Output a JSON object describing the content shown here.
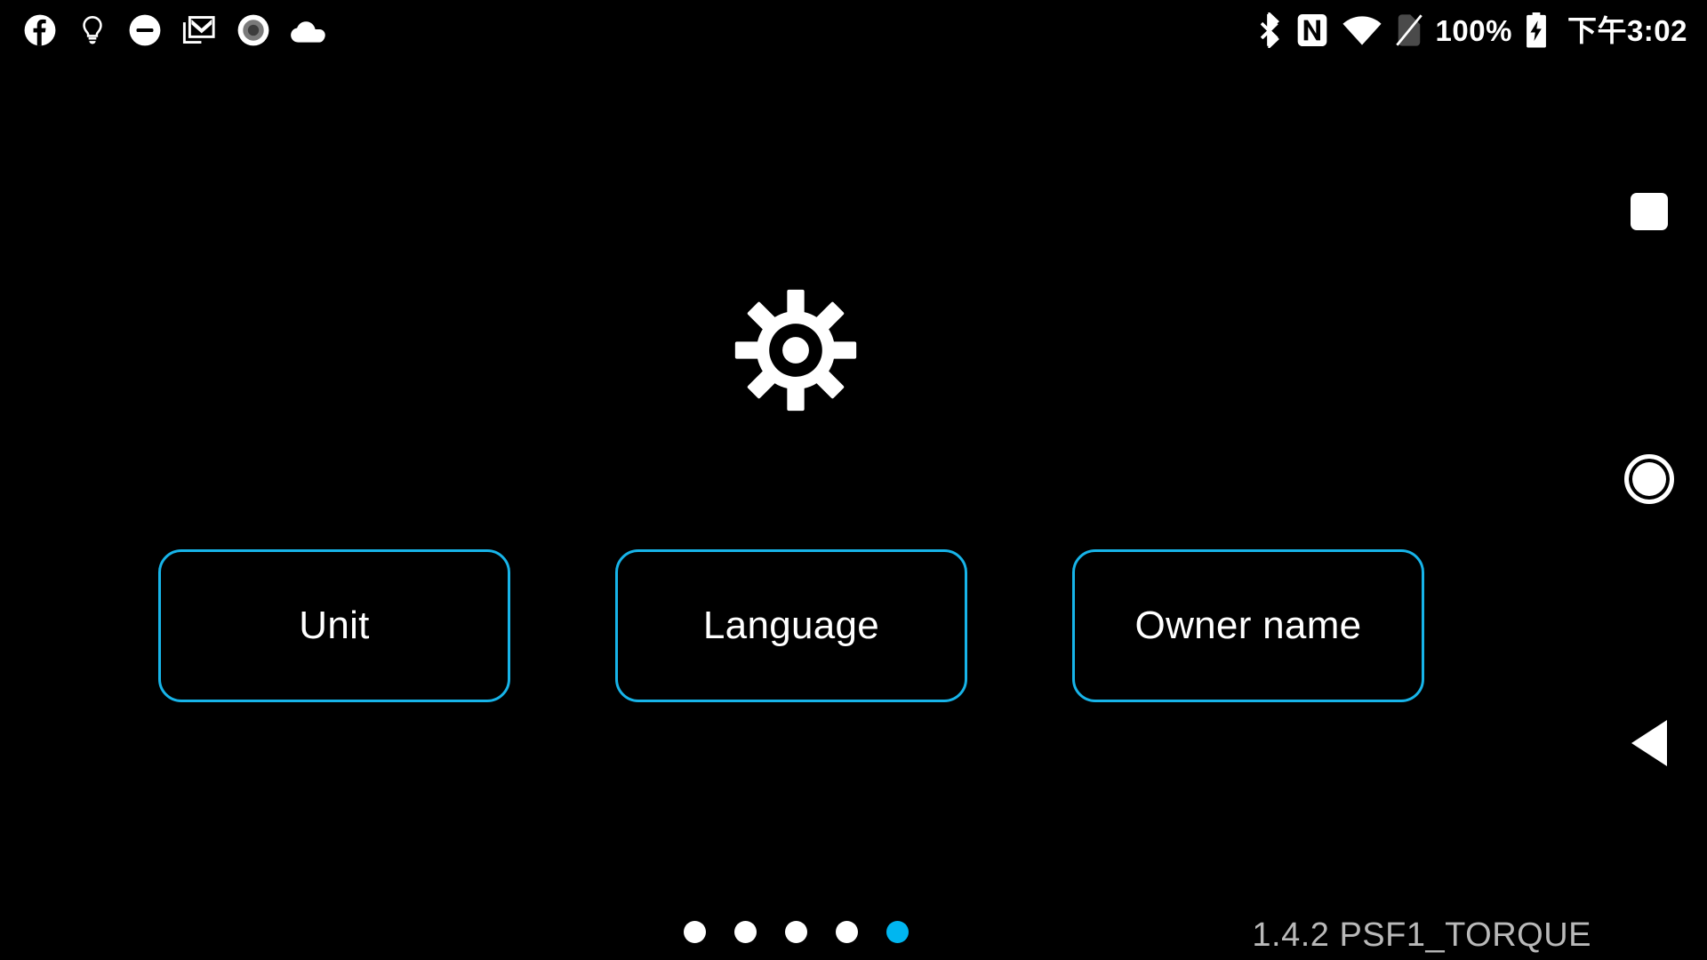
{
  "status_bar": {
    "left_icons": [
      {
        "name": "facebook-icon",
        "label": "Facebook"
      },
      {
        "name": "lightbulb-icon",
        "label": "Tips"
      },
      {
        "name": "do-not-disturb-icon",
        "label": "Do not disturb"
      },
      {
        "name": "gmail-icon",
        "label": "Gmail"
      },
      {
        "name": "screen-record-icon",
        "label": "Screen recorder"
      },
      {
        "name": "cloud-icon",
        "label": "Cloud sync"
      }
    ],
    "right_icons": [
      {
        "name": "bluetooth-icon",
        "label": "Bluetooth"
      },
      {
        "name": "nfc-icon",
        "label": "NFC"
      },
      {
        "name": "wifi-icon",
        "label": "Wi-Fi"
      },
      {
        "name": "sim-card-off-icon",
        "label": "No SIM"
      }
    ],
    "battery_percent": "100%",
    "battery_icon": "battery-charging-icon",
    "clock": "下午3:02"
  },
  "main": {
    "header_icon": "settings-gear-icon",
    "buttons": [
      {
        "id": "unit",
        "label": "Unit"
      },
      {
        "id": "language",
        "label": "Language"
      },
      {
        "id": "owner-name",
        "label": "Owner name"
      }
    ]
  },
  "footer": {
    "page_dots": {
      "total": 5,
      "active_index": 4
    },
    "version_text": "1.4.2 PSF1_TORQUE"
  },
  "nav_bar": {
    "recent_label": "Recent apps",
    "home_label": "Home",
    "back_label": "Back"
  },
  "colors": {
    "background": "#000000",
    "accent_cyan": "#17B4E9",
    "dot_active": "#00B6F0",
    "text_primary": "#FFFFFF",
    "version_text": "#B9B9B9"
  }
}
